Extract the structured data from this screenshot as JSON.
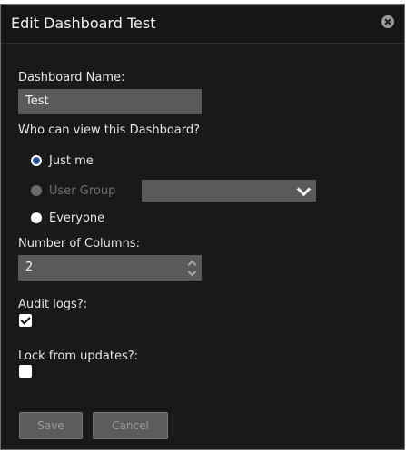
{
  "dialog": {
    "title": "Edit Dashboard Test"
  },
  "form": {
    "name_label": "Dashboard Name:",
    "name_value": "Test",
    "visibility_label": "Who can view this Dashboard?",
    "visibility_options": [
      {
        "label": "Just me",
        "state": "selected"
      },
      {
        "label": "User Group",
        "state": "disabled"
      },
      {
        "label": "Everyone",
        "state": "unselected"
      }
    ],
    "user_group_select_value": "",
    "columns_label": "Number of Columns:",
    "columns_value": "2",
    "audit_label": "Audit logs?:",
    "audit_checked": true,
    "lock_label": "Lock from updates?:",
    "lock_checked": false
  },
  "buttons": {
    "save_label": "Save",
    "cancel_label": "Cancel"
  },
  "colors": {
    "dialog_background": "#191919",
    "input_background": "#5a5a5a",
    "radio_selected": "#2f5fa8"
  }
}
